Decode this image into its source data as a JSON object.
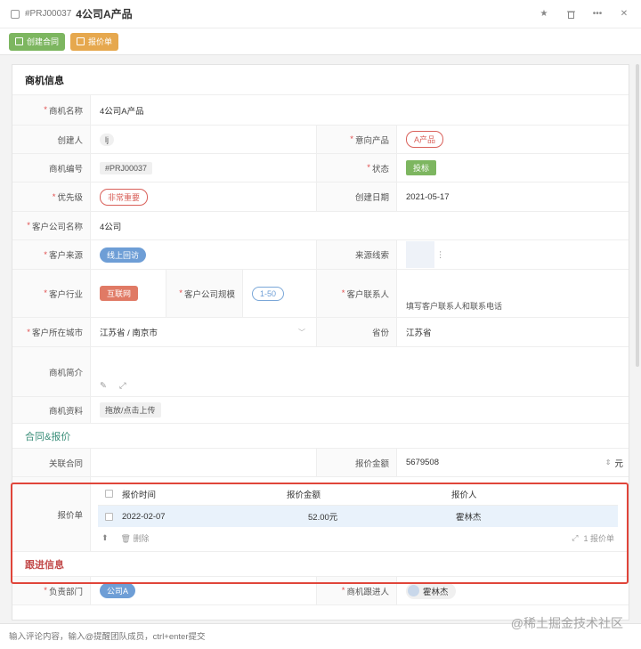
{
  "header": {
    "project_id": "#PRJ00037",
    "title": "4公司A产品"
  },
  "actions": {
    "create_contract": "创建合同",
    "quote": "报价单"
  },
  "section_deal": "商机信息",
  "fields": {
    "deal_name": {
      "label": "商机名称",
      "value": "4公司A产品"
    },
    "creator": {
      "label": "创建人",
      "value": "lj"
    },
    "product": {
      "label": "意向产品",
      "value": "A产品"
    },
    "deal_no": {
      "label": "商机编号",
      "value": "#PRJ00037"
    },
    "status": {
      "label": "状态",
      "value": "投标"
    },
    "priority": {
      "label": "优先级",
      "value": "非常重要"
    },
    "created_date": {
      "label": "创建日期",
      "value": "2021-05-17"
    },
    "company": {
      "label": "客户公司名称",
      "value": "4公司"
    },
    "source": {
      "label": "客户来源",
      "value": "线上回访"
    },
    "lead_source": {
      "label": "来源线索",
      "value": ""
    },
    "industry": {
      "label": "客户行业",
      "value": "互联网"
    },
    "company_size": {
      "label": "客户公司规模",
      "value": "1-50"
    },
    "contact": {
      "label": "客户联系人",
      "value": "填写客户联系人和联系电话"
    },
    "city": {
      "label": "客户所在城市",
      "value": "江苏省 / 南京市"
    },
    "province": {
      "label": "省份",
      "value": "江苏省"
    },
    "intro": {
      "label": "商机简介"
    },
    "docs": {
      "label": "商机资料",
      "value": "拖放/点击上传"
    }
  },
  "section_contract": "合同&报价",
  "contract": {
    "linked_label": "关联合同",
    "amount_label": "报价金额",
    "amount_value": "5679508",
    "amount_unit": "元",
    "quote_label": "报价单"
  },
  "quote_table": {
    "headers": [
      "报价时间",
      "报价金额",
      "报价人"
    ],
    "rows": [
      {
        "time": "2022-02-07",
        "amount": "52.00元",
        "person": "霍林杰"
      }
    ],
    "delete_label": "删除",
    "count_label": "1 报价单"
  },
  "section_follow": "跟进信息",
  "follow": {
    "dept_label": "负责部门",
    "dept_value": "公司A",
    "follower_label": "商机跟进人",
    "follower_value": "霍林杰"
  },
  "comment": {
    "placeholder": "输入评论内容，输入@提醒团队成员，ctrl+enter提交"
  },
  "watermark": "@稀土掘金技术社区"
}
